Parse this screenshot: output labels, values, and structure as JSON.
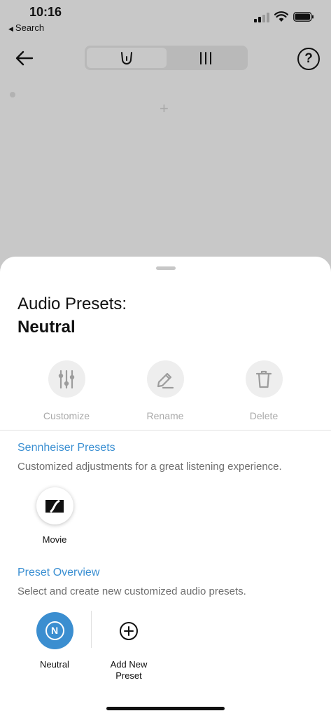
{
  "status_bar": {
    "time": "10:16",
    "back_app_label": "Search",
    "back_app_glyph": "◀"
  },
  "nav": {
    "back_icon": "back-arrow-icon",
    "tabs": [
      {
        "name": "sound-mode-icon",
        "active": true
      },
      {
        "name": "equalizer-bars-icon",
        "active": false
      }
    ],
    "help_glyph": "?"
  },
  "background": {
    "plus_glyph": "+"
  },
  "sheet": {
    "title": "Audio Presets:",
    "current_preset": "Neutral",
    "actions": [
      {
        "label": "Customize",
        "icon": "sliders-icon",
        "enabled": false
      },
      {
        "label": "Rename",
        "icon": "pencil-icon",
        "enabled": false
      },
      {
        "label": "Delete",
        "icon": "trash-icon",
        "enabled": false
      }
    ],
    "sennheiser": {
      "title": "Sennheiser Presets",
      "description": "Customized adjustments for a great listening experience.",
      "presets": [
        {
          "label": "Movie",
          "icon": "sennheiser-logo-icon"
        }
      ]
    },
    "overview": {
      "title": "Preset Overview",
      "description": "Select and create new customized audio presets.",
      "presets": [
        {
          "label": "Neutral",
          "badge": "N",
          "selected": true
        }
      ],
      "add_label_line1": "Add New",
      "add_label_line2": "Preset"
    }
  },
  "colors": {
    "accent": "#3b8ed0",
    "disabled": "#a9a9a9",
    "overlay": "#c8c8c8"
  }
}
